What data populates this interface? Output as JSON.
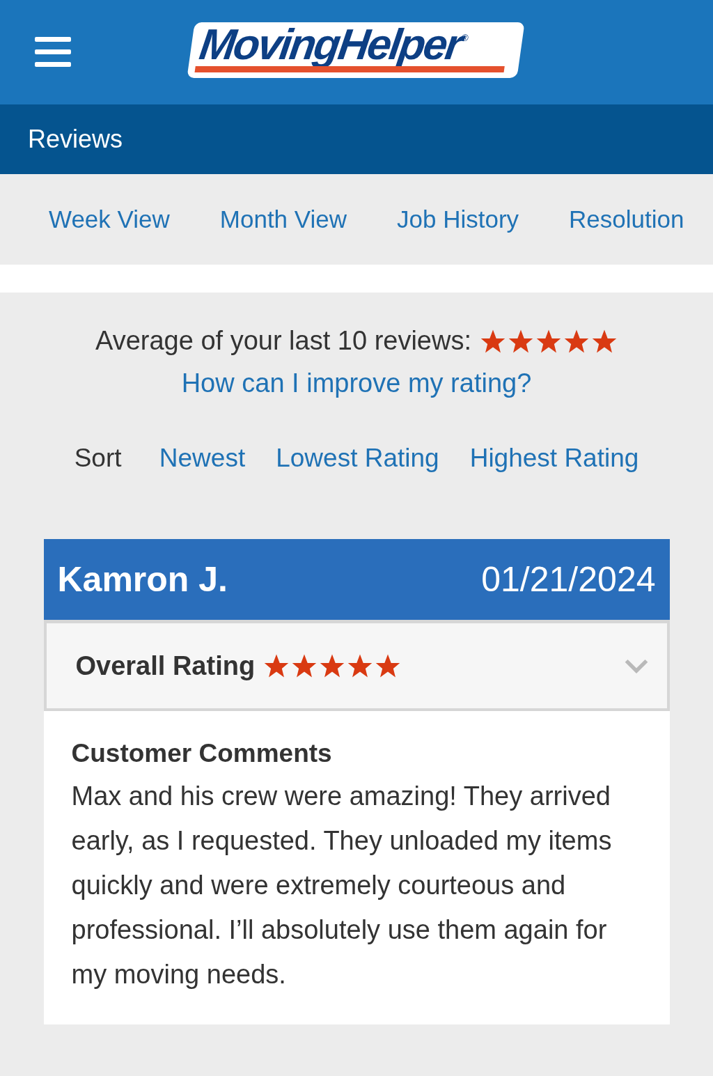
{
  "header": {
    "logo": "MovingHelper",
    "logo_mark": "®"
  },
  "page_title": "Reviews",
  "tabs": [
    {
      "label": "Week View"
    },
    {
      "label": "Month View"
    },
    {
      "label": "Job History"
    },
    {
      "label": "Resolution"
    }
  ],
  "summary": {
    "text": "Average of your last 10 reviews:",
    "stars": 5,
    "link": "How can I improve my rating?"
  },
  "sort": {
    "label": "Sort",
    "options": [
      "Newest",
      "Lowest Rating",
      "Highest Rating"
    ]
  },
  "review": {
    "name": "Kamron J.",
    "date": "01/21/2024",
    "rating_label": "Overall Rating",
    "stars": 5,
    "expanded": false,
    "comments_title": "Customer Comments",
    "comments": "Max and his crew were amazing! They arrived early, as I requested. They unloaded my items quickly and were extremely courteous and professional. I’ll absolutely use them again for my moving needs."
  }
}
